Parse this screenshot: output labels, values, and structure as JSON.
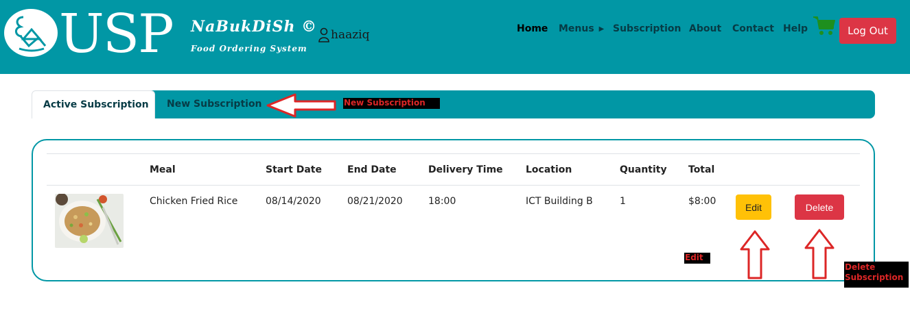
{
  "header": {
    "logo_text": "USP",
    "brand_title": "NaBukDiSh ©",
    "brand_subtitle": "Food Ordering System",
    "username": "haaziq",
    "nav": [
      {
        "label": "Home"
      },
      {
        "label": "Menus"
      },
      {
        "label": "Subscription"
      },
      {
        "label": "About"
      },
      {
        "label": "Contact"
      },
      {
        "label": "Help"
      }
    ],
    "logout_label": "Log Out"
  },
  "tabs": {
    "active": "Active Subscription",
    "new": "New Subscription"
  },
  "annotations": {
    "new_subscription": "New Subscription",
    "edit": "Edit",
    "delete_line1": "Delete",
    "delete_line2": "Subscription"
  },
  "table": {
    "columns": [
      "Meal",
      "Start Date",
      "End Date",
      "Delivery Time",
      "Location",
      "Quantity",
      "Total"
    ],
    "rows": [
      {
        "meal": "Chicken Fried Rice",
        "start_date": "08/14/2020",
        "end_date": "08/21/2020",
        "delivery_time": "18:00",
        "location": "ICT Building B",
        "quantity": "1",
        "total": "$8:00",
        "edit_label": "Edit",
        "delete_label": "Delete"
      }
    ]
  },
  "colors": {
    "brand_teal": "#0197a5",
    "danger": "#dc3545",
    "warning": "#ffc107",
    "cart_green": "#1e8f1e",
    "annotation_red": "#dc2626"
  },
  "icons": {
    "cart": "shopping-cart-icon",
    "user": "user-icon",
    "menu_caret": "caret-right-icon"
  }
}
